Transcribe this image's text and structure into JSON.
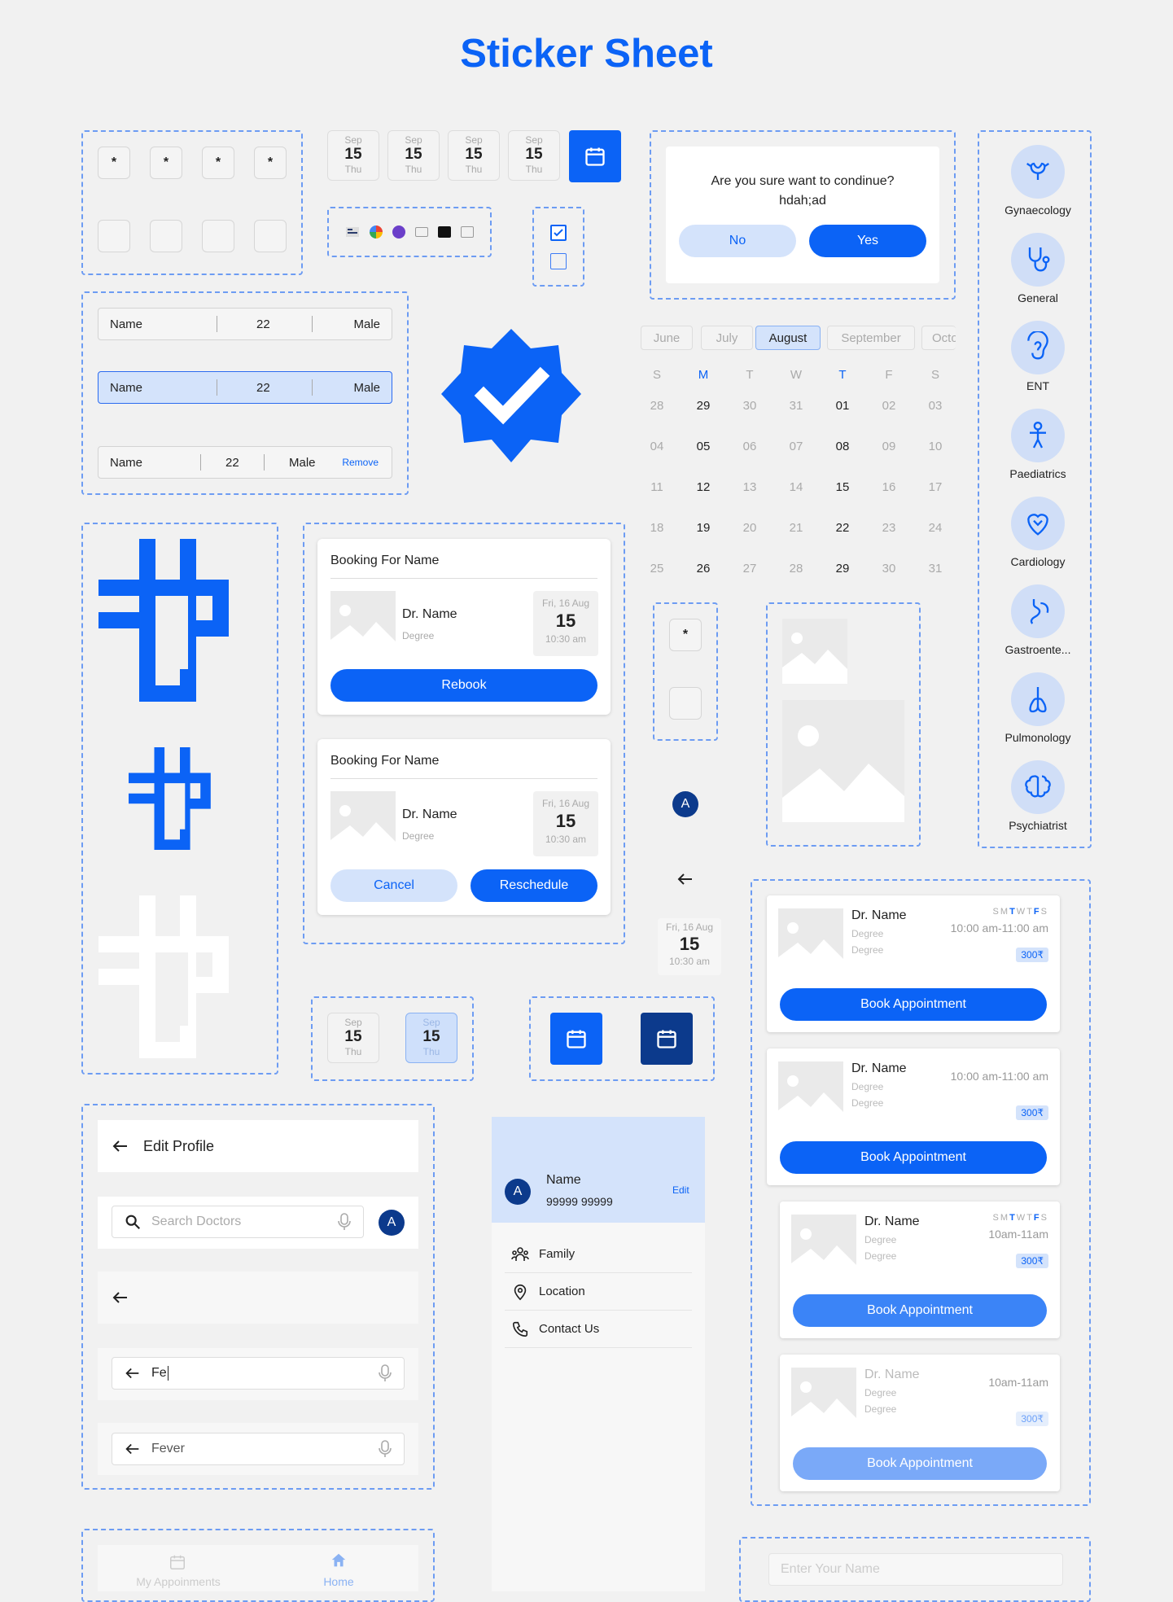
{
  "title": "Sticker Sheet",
  "otp": {
    "dot": "*"
  },
  "date_chips": {
    "month": "Sep",
    "day": "15",
    "weekday": "Thu"
  },
  "dialog": {
    "question": "Are you sure want to condinue?",
    "sub": "hdah;ad",
    "no": "No",
    "yes": "Yes"
  },
  "specialities": [
    {
      "label": "Gynaecology",
      "icon": "uterus-icon"
    },
    {
      "label": "General",
      "icon": "stethoscope-icon"
    },
    {
      "label": "ENT",
      "icon": "ear-icon"
    },
    {
      "label": "Paediatrics",
      "icon": "child-icon"
    },
    {
      "label": "Cardiology",
      "icon": "heart-icon"
    },
    {
      "label": "Gastroente...",
      "icon": "stomach-icon"
    },
    {
      "label": "Pulmonology",
      "icon": "lungs-icon"
    },
    {
      "label": "Psychiatrist",
      "icon": "brain-icon"
    }
  ],
  "info_rows": [
    {
      "name": "Name",
      "age": "22",
      "gender": "Male"
    },
    {
      "name": "Name",
      "age": "22",
      "gender": "Male"
    },
    {
      "name": "Name",
      "age": "22",
      "gender": "Male",
      "action": "Remove"
    }
  ],
  "months": [
    "June",
    "July",
    "August",
    "September",
    "Octo"
  ],
  "weekdays": [
    "S",
    "M",
    "T",
    "W",
    "T",
    "F",
    "S"
  ],
  "calendar": [
    [
      "28",
      "29",
      "30",
      "31",
      "01",
      "02",
      "03"
    ],
    [
      "04",
      "05",
      "06",
      "07",
      "08",
      "09",
      "10"
    ],
    [
      "11",
      "12",
      "13",
      "14",
      "15",
      "16",
      "17"
    ],
    [
      "18",
      "19",
      "20",
      "21",
      "22",
      "23",
      "24"
    ],
    [
      "25",
      "26",
      "27",
      "28",
      "29",
      "30",
      "31"
    ]
  ],
  "booking": [
    {
      "for": "Booking For Name",
      "doctor": "Dr. Name",
      "degree": "Degree",
      "date": "Fri, 16 Aug",
      "day": "15",
      "time": "10:30 am",
      "primary": "Rebook"
    },
    {
      "for": "Booking For Name",
      "doctor": "Dr. Name",
      "degree": "Degree",
      "date": "Fri, 16 Aug",
      "day": "15",
      "time": "10:30 am",
      "secondary": "Cancel",
      "primary": "Reschedule"
    }
  ],
  "avatar": "A",
  "standalone_date": {
    "date": "Fri, 16 Aug",
    "day": "15",
    "time": "10:30 am"
  },
  "appointments": [
    {
      "doctor": "Dr. Name",
      "degree1": "Degree",
      "degree2": "Degree",
      "days": "S M T W T F S",
      "time": "10:00 am-11:00 am",
      "fee": "300₹",
      "button": "Book Appointment"
    },
    {
      "doctor": "Dr. Name",
      "degree1": "Degree",
      "degree2": "Degree",
      "time": "10:00 am-11:00 am",
      "fee": "300₹",
      "button": "Book Appointment"
    },
    {
      "doctor": "Dr. Name",
      "degree1": "Degree",
      "degree2": "Degree",
      "days": "S M T W T F S",
      "time": "10am-11am",
      "fee": "300₹",
      "button": "Book Appointment"
    },
    {
      "doctor": "Dr. Name",
      "degree1": "Degree",
      "degree2": "Degree",
      "time": "10am-11am",
      "fee": "300₹",
      "button": "Book Appointment"
    }
  ],
  "edit_profile": {
    "title": "Edit Profile",
    "search_placeholder": "Search Doctors",
    "typing": "Fe",
    "fever": "Fever"
  },
  "drawer": {
    "name": "Name",
    "phone": "99999 99999",
    "edit": "Edit",
    "items": [
      "Family",
      "Location",
      "Contact Us"
    ]
  },
  "bottom_nav": {
    "appointments": "My Appoinments",
    "home": "Home"
  },
  "name_input": {
    "placeholder": "Enter Your Name"
  },
  "colors": {
    "primary": "#0b63f6",
    "light": "#d4e3fb",
    "dark": "#0c3a8c"
  }
}
